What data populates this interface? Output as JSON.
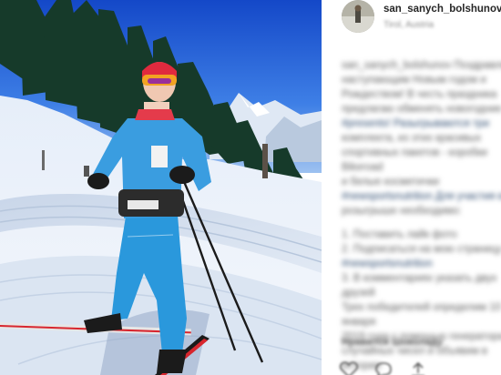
{
  "post": {
    "username": "san_sanych_bolshunov",
    "location": "Tirol, Austria",
    "caption": {
      "lines": [
        "san_sanych_bolshunov Поздравляю с",
        "наступающим Новым годом и",
        "Рождеством! В честь праздника",
        "предлагаю обменять новогодние",
        "#presents! Разыгрываются три",
        "комплекта, из этих красивых",
        "спортивных пакетов - коробки Bikeroad",
        "и белые косметички",
        "#newsportsnutrition Для участия в",
        "розыгрыше необходимо:"
      ],
      "steps": [
        "1. Поставить лайк фото",
        "2. Подписаться на мою страницу и",
        "#newsportsnutrition",
        "3. В комментариях указать двух друзей",
        "Трех победителей определим 10 января",
        "2019 года с помощью генератора",
        "случайных чисел и объявим в истории"
      ]
    },
    "likes": "Нравится Шоколаду"
  },
  "icons": {
    "like": "heart-icon",
    "comment": "comment-icon",
    "share": "share-icon",
    "avatar": "skier-avatar"
  },
  "colors": {
    "jacket": "#3196d8",
    "sky": "#1f5fd9",
    "snow": "#eef3fa",
    "link": "#27456b"
  }
}
